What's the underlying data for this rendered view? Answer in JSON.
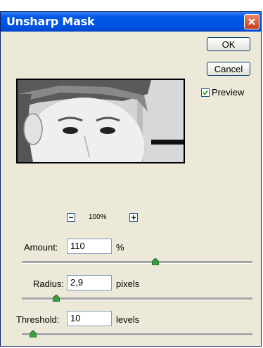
{
  "window": {
    "title": "Unsharp Mask"
  },
  "buttons": {
    "ok": "OK",
    "cancel": "Cancel"
  },
  "preview": {
    "label": "Preview",
    "checked": true
  },
  "zoom": {
    "level": "100%"
  },
  "amount": {
    "label": "Amount:",
    "value": "110",
    "unit": "%",
    "slider_fraction": 0.58
  },
  "radius": {
    "label": "Radius:",
    "value": "2,9",
    "unit": "pixels",
    "slider_fraction": 0.15
  },
  "threshold": {
    "label": "Threshold:",
    "value": "10",
    "unit": "levels",
    "slider_fraction": 0.05
  },
  "colors": {
    "titlebar": "#0054e3",
    "dialog_bg": "#ece9d8",
    "close": "#c8401c",
    "slider_thumb": "#3ca040"
  }
}
